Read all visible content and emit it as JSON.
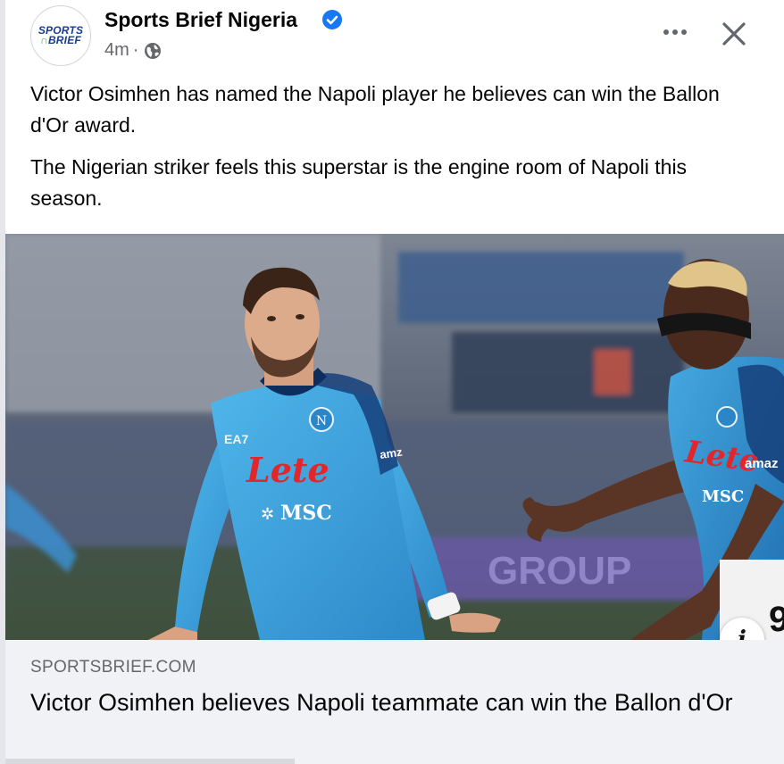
{
  "post": {
    "page_name": "Sports Brief Nigeria",
    "timestamp": "4m",
    "separator": "·",
    "avatar": {
      "logo_top": "SPORTS",
      "logo_bottom": "BRIEF"
    },
    "verified_color": "#1877f2",
    "icons": {
      "more": "more-options-icon",
      "close": "close-icon",
      "audience": "globe-icon",
      "info": "info-icon"
    },
    "text": {
      "paragraph_1": "Victor Osimhen has named the Napoli player he believes can win the Ballon d'Or award.",
      "paragraph_2": "The Nigerian striker feels this superstar is the engine room of Napoli this season."
    },
    "image": {
      "jersey_left": {
        "sponsor": "Lete",
        "brand": "MSC",
        "kit": "EA7",
        "sleeve": "amz"
      },
      "jersey_right": {
        "sponsor": "Lete",
        "brand": "MSC",
        "sleeve": "amaz"
      },
      "board_text": "GROUP"
    },
    "info_label": "i",
    "link": {
      "domain": "SPORTSBRIEF.COM",
      "title": "Victor Osimhen believes Napoli teammate can win the Ballon d'Or"
    }
  }
}
